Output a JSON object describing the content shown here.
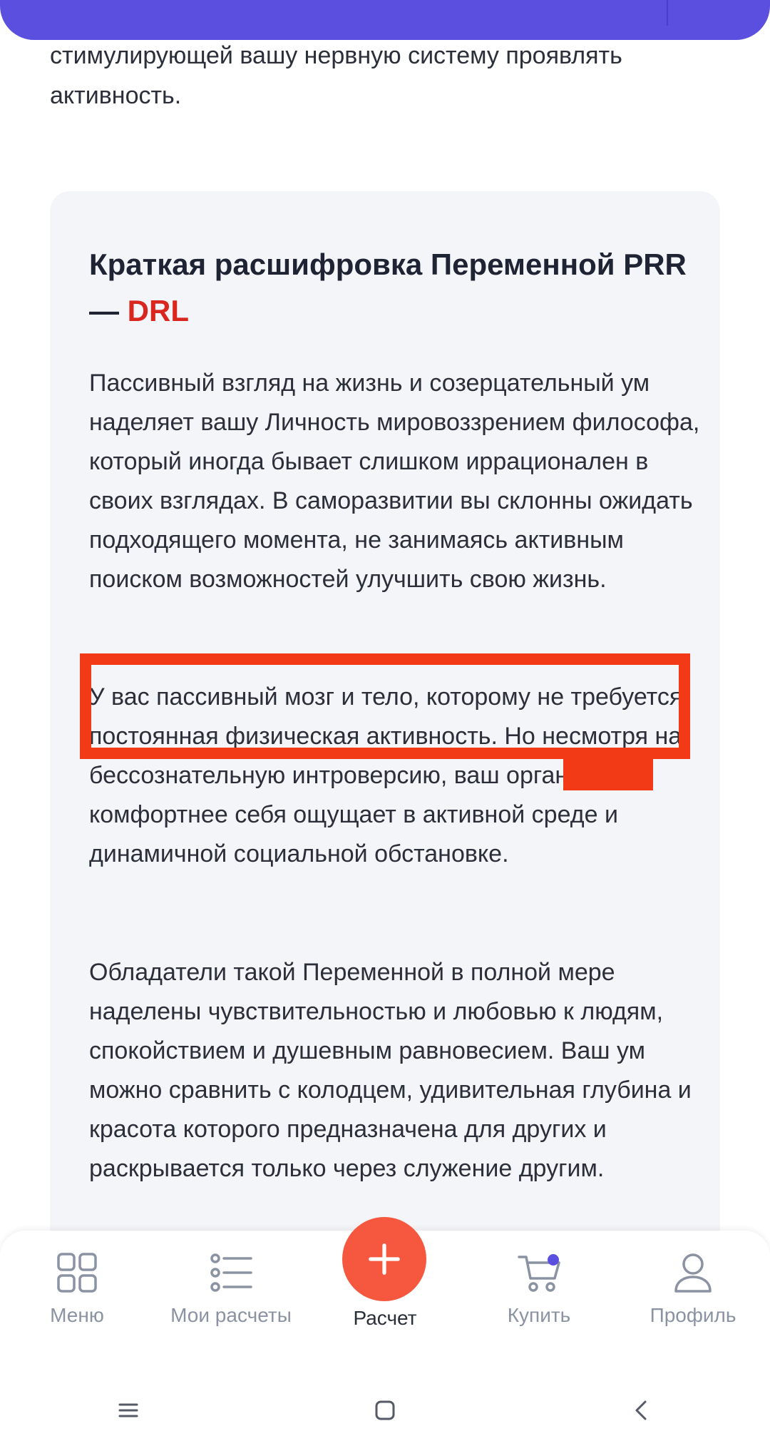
{
  "intro_text": "стимулирующей вашу нервную систему проявлять активность.",
  "card": {
    "title_prefix": "Краткая расшифровка Переменной PRR — ",
    "title_accent": "DRL",
    "paragraph_1": "Пассивный взгляд на жизнь и созерцательный ум наделяет вашу Личность мировоззрением философа, который иногда бывает слишком иррационален в своих взглядах. В саморазвитии вы склонны ожидать подходящего момента, не занимаясь активным поиском возможностей улучшить свою жизнь.",
    "paragraph_2": "У вас пассивный мозг и тело, которому не требуется постоянная физическая активность. Но несмотря на бессознательную интроверсию, ваш организм комфортнее себя ощущает в активной среде и динамичной социальной обстановке.",
    "paragraph_3": "Обладатели такой Переменной в полной мере наделены чувствительностью и любовью к людям, спокойствием и душевным равновесием. Ваш ум можно сравнить с колодцем, удивительная глубина и красота которого предназначена для других и раскрывается только через служение другим."
  },
  "nav": {
    "menu": "Меню",
    "my_calcs": "Мои расчеты",
    "calc": "Расчет",
    "buy": "Купить",
    "profile": "Профиль"
  },
  "colors": {
    "brand": "#5b4fe0",
    "accent_red": "#d9271f",
    "fab": "#f6573f",
    "annotation": "#f33a17"
  },
  "icons": {
    "menu": "grid-icon",
    "my_calcs": "list-icon",
    "calc": "plus-icon",
    "buy": "cart-icon",
    "profile": "user-icon"
  }
}
